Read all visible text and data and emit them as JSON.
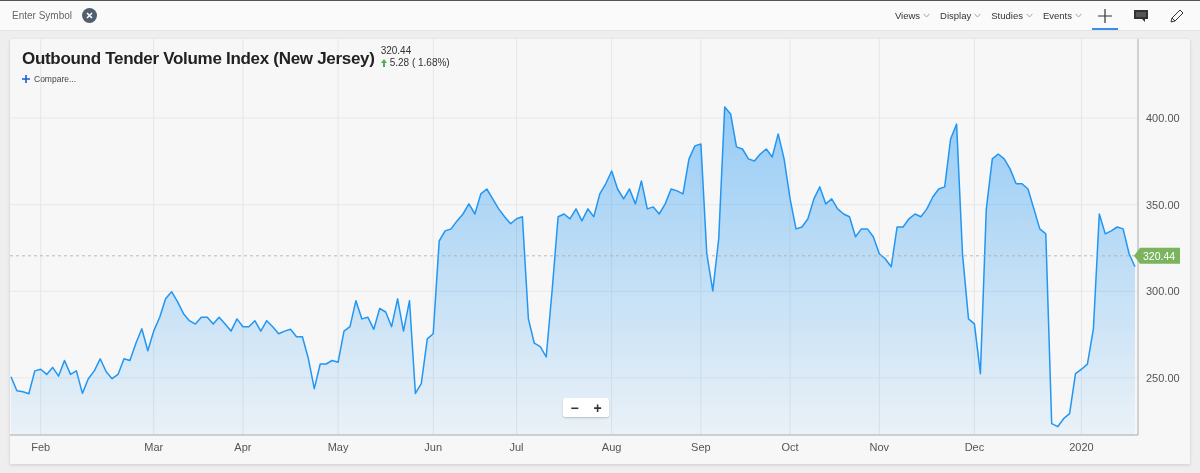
{
  "toolbar": {
    "symbol_placeholder": "Enter Symbol",
    "menus": [
      "Views",
      "Display",
      "Studies",
      "Events"
    ],
    "tools": [
      {
        "kind": "crosshair",
        "selected": true
      },
      {
        "kind": "comment",
        "selected": false
      },
      {
        "kind": "pencil",
        "selected": false
      }
    ]
  },
  "chart": {
    "price": "320.44",
    "change": "5.28 ( 1.68%)",
    "compare_link": "Compare...",
    "zoom_buttons": [
      "−",
      "+"
    ],
    "chart_data": {
      "type": "area",
      "title": "Outbound Tender Volume Index (New Jersey)",
      "categories": [
        null,
        null,
        null,
        null,
        null,
        "Feb",
        null,
        null,
        null,
        null,
        null,
        null,
        null,
        null,
        null,
        null,
        null,
        null,
        null,
        null,
        null,
        null,
        null,
        null,
        "Mar",
        null,
        null,
        null,
        null,
        null,
        null,
        null,
        null,
        null,
        null,
        null,
        null,
        null,
        null,
        "Apr",
        null,
        null,
        null,
        null,
        null,
        null,
        null,
        null,
        null,
        null,
        null,
        null,
        null,
        null,
        null,
        "May",
        null,
        null,
        null,
        null,
        null,
        null,
        null,
        null,
        null,
        null,
        null,
        null,
        null,
        null,
        null,
        "Jun",
        null,
        null,
        null,
        null,
        null,
        null,
        null,
        null,
        null,
        null,
        null,
        null,
        null,
        "Jul",
        null,
        null,
        null,
        null,
        null,
        null,
        null,
        null,
        null,
        null,
        null,
        null,
        null,
        null,
        null,
        "Aug",
        null,
        null,
        null,
        null,
        null,
        null,
        null,
        null,
        null,
        null,
        null,
        null,
        null,
        null,
        "Sep",
        null,
        null,
        null,
        null,
        null,
        null,
        null,
        null,
        null,
        null,
        null,
        null,
        null,
        null,
        "Oct",
        null,
        null,
        null,
        null,
        null,
        null,
        null,
        null,
        null,
        null,
        null,
        null,
        null,
        null,
        "Nov",
        null,
        null,
        null,
        null,
        null,
        null,
        null,
        null,
        null,
        null,
        null,
        null,
        null,
        null,
        null,
        "Dec",
        null,
        null,
        null,
        null,
        null,
        null,
        null,
        null,
        null,
        null,
        null,
        null,
        null,
        null,
        null,
        null,
        null,
        "2020",
        null,
        null,
        null,
        null,
        null,
        null,
        null,
        null,
        null
      ],
      "series": [
        {
          "color": "#2196f3",
          "values": [
            250.6,
            242.6,
            242,
            240.8,
            254,
            255,
            252,
            256,
            251,
            260,
            252,
            254,
            241,
            249.5,
            254,
            261,
            253.5,
            249.5,
            252,
            261,
            260,
            270,
            278.3,
            265.6,
            277,
            285,
            295.6,
            299.7,
            294,
            287,
            283,
            281,
            285,
            285,
            281,
            285,
            281,
            277,
            284,
            279.5,
            279.5,
            283,
            277,
            283,
            279.5,
            275.4,
            277,
            278,
            273.7,
            273.7,
            261,
            243.7,
            258,
            258,
            260,
            259,
            277,
            279.5,
            294.5,
            284,
            285,
            278,
            290,
            288,
            279.5,
            295.6,
            277,
            294.5,
            241,
            246.6,
            272.5,
            275.4,
            329,
            334.8,
            336,
            340.6,
            344.6,
            350.4,
            344.6,
            356.2,
            359,
            353.3,
            347.5,
            343,
            338.9,
            341.8,
            343,
            284,
            270,
            268,
            262,
            301,
            343,
            344.6,
            341.8,
            347.5,
            340.6,
            347.5,
            343,
            356.2,
            362,
            369.4,
            359,
            353.3,
            359,
            350.4,
            363.7,
            347.5,
            348.7,
            344.6,
            350.4,
            359,
            357.9,
            356.2,
            376.4,
            383.9,
            385,
            321.6,
            300.2,
            330.2,
            406.3,
            402.3,
            383.3,
            382.1,
            376.4,
            375.2,
            379.2,
            382.1,
            377.5,
            390.8,
            376.4,
            353.3,
            336,
            337.1,
            341.8,
            353.3,
            360.2,
            350.4,
            353.3,
            347.5,
            344.6,
            343,
            331.4,
            336,
            336,
            331.4,
            321.6,
            318.7,
            314.1,
            337.1,
            337.1,
            341.8,
            344.6,
            343,
            347.5,
            354.4,
            359,
            360.2,
            387.9,
            396.5,
            321.6,
            284,
            281.2,
            252.4,
            347.5,
            376.4,
            379.2,
            376.4,
            370.6,
            362,
            362,
            359,
            347.5,
            336,
            333.1,
            223.5,
            221.8,
            226.4,
            229.3,
            252.4,
            255,
            257.9,
            278.3,
            344.6,
            333.1,
            334.8,
            337.1,
            336,
            321.6,
            314.1
          ]
        }
      ],
      "ylim": [
        217,
        445.6
      ],
      "grid": true,
      "yticks": [
        {
          "value": 250,
          "label": "250.00"
        },
        {
          "value": 300,
          "label": "300.00"
        },
        {
          "value": 350,
          "label": "350.00"
        },
        {
          "value": 400,
          "label": "400.00"
        }
      ],
      "ref_lines": [
        {
          "axis": "y",
          "value": 320.44,
          "label": "320.44"
        }
      ]
    }
  }
}
